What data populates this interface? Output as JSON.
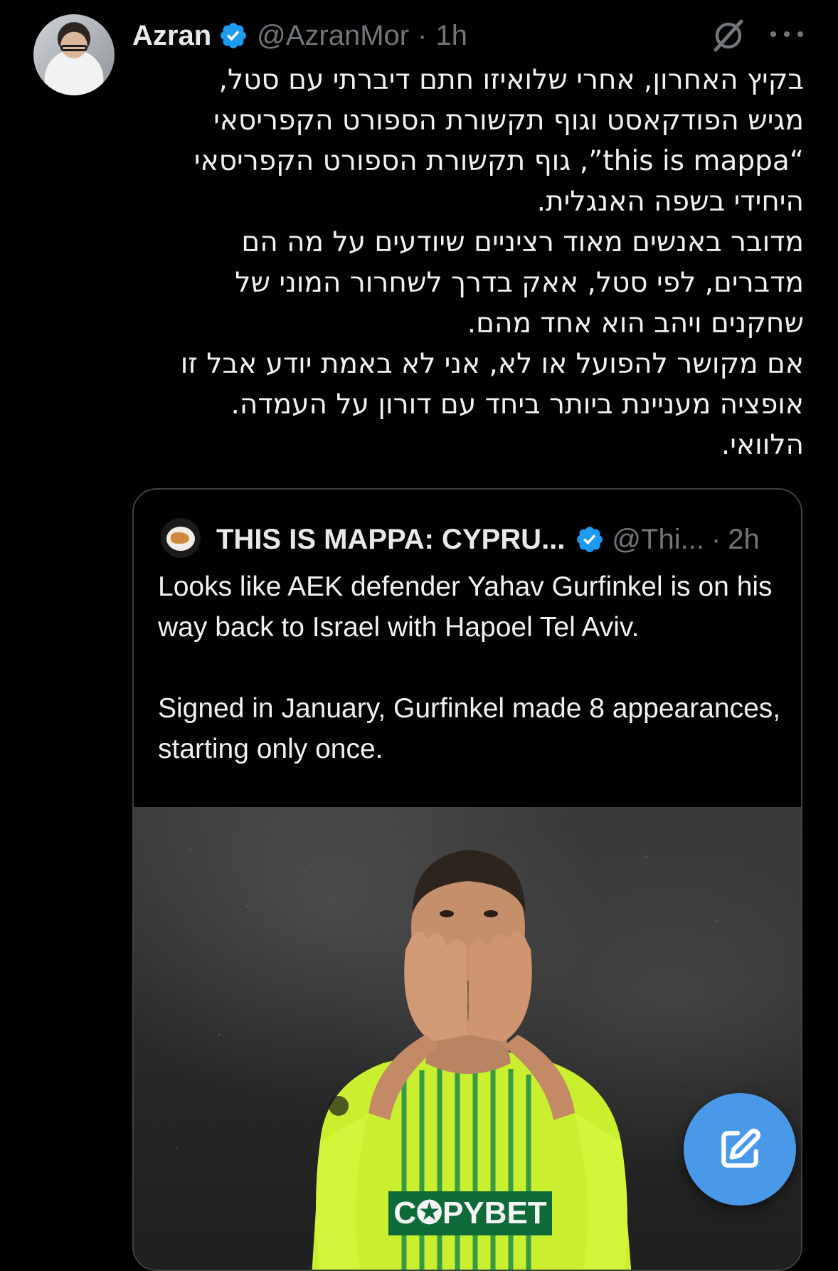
{
  "author": {
    "name": "Azran",
    "handle": "@AzranMor",
    "separator": "·",
    "time": "1h"
  },
  "tweet": {
    "text": "בקיץ האחרון, אחרי שלואיזו חתם דיברתי עם סטל,\nמגיש הפודקאסט וגוף תקשורת הספורט הקפריסאי\n“this is mappa”, גוף תקשורת הספורט הקפריסאי\nהיחידי בשפה האנגלית.\nמדובר באנשים מאוד רציניים שיודעים על מה הם\nמדברים, לפי סטל, אאק בדרך לשחרור המוני של\nשחקנים ויהב הוא אחד מהם.\nאם מקושר להפועל או לא, אני לא באמת יודע אבל זו\nאופציה מעניינת ביותר ביחד עם דורון על העמדה.\nהלוואי."
  },
  "quote": {
    "name": "THIS IS MAPPA: CYPRU...",
    "handle": "@Thi...",
    "separator": "·",
    "time": "2h",
    "text_1": "Looks like AEK defender Yahav Gurfinkel is on his way back to Israel with Hapoel Tel Aviv.",
    "text_2": "Signed in January, Gurfinkel made 8 appearances, starting only once.",
    "image": {
      "jersey_text": "C✪PYBET"
    }
  },
  "colors": {
    "background": "#000000",
    "verified": "#1d9bf0",
    "fab": "#4a99e9",
    "muted": "#71767b"
  },
  "icons": {
    "verified": "verified-badge-icon",
    "grok": "grok-icon",
    "more": "more-icon",
    "compose": "compose-icon"
  }
}
